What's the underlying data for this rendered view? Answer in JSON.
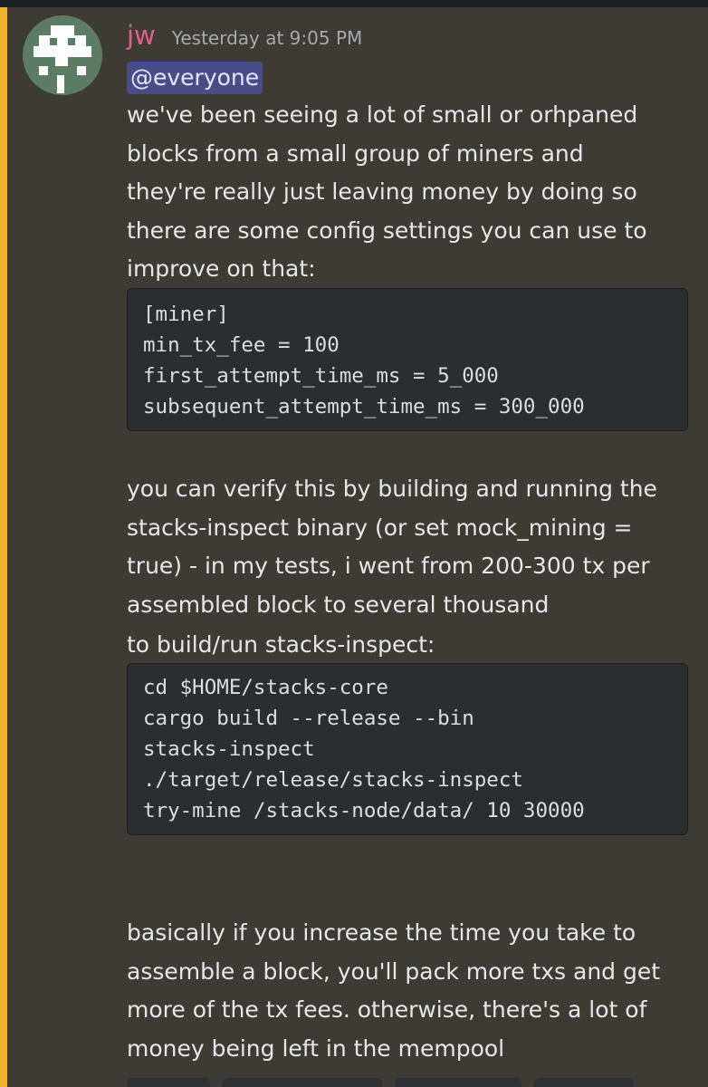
{
  "message": {
    "username": "jw",
    "timestamp": "Yesterday at 9:05 PM",
    "mention": "@everyone",
    "paragraph_1": [
      "we've been seeing a lot of small or orhpaned",
      "blocks from a small group of miners and",
      "they're really just leaving money by doing so",
      "there are some config settings you can use to",
      "improve on that:"
    ],
    "code_block_1": [
      "[miner]",
      "min_tx_fee = 100",
      "first_attempt_time_ms = 5_000",
      "subsequent_attempt_time_ms = 300_000"
    ],
    "paragraph_2": [
      "you can verify this by building and running the",
      "stacks-inspect binary (or set mock_mining =",
      "true) - in my tests, i went from 200-300 tx per",
      "assembled block to several thousand"
    ],
    "paragraph_3": "to build/run stacks-inspect:",
    "code_block_2": [
      "cd $HOME/stacks-core",
      "cargo build --release --bin",
      "stacks-inspect",
      "./target/release/stacks-inspect",
      "try-mine /stacks-node/data/ 10 30000"
    ],
    "paragraph_4": [
      "basically if you increase the time you take to",
      "assemble a block, you'll pack more txs and get",
      "more of the tx fees. otherwise, there's a lot of",
      "money being left in the mempool"
    ]
  },
  "colors": {
    "background": "#36383f",
    "mention_highlight_bg": "#3e3b34",
    "mention_bar": "#f0b232",
    "username": "#e45b8f",
    "mention_pill": "#4a4c86",
    "code_bg": "#2b2d31"
  },
  "avatar": {
    "icon": "pixel-invader-avatar"
  }
}
